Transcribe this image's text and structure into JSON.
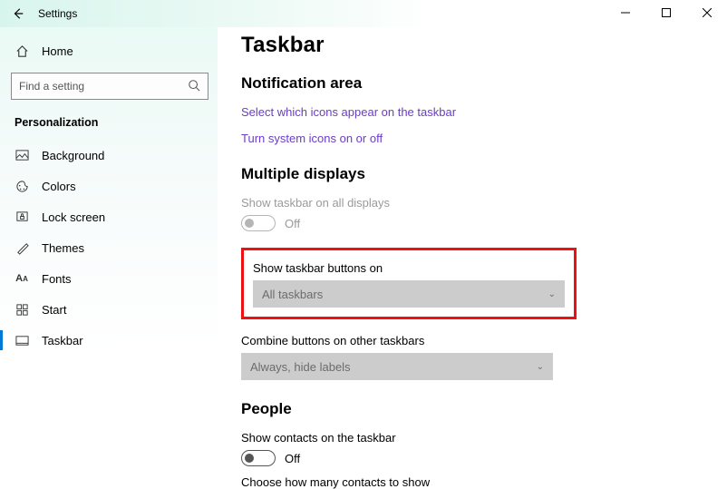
{
  "header": {
    "title": "Settings"
  },
  "sidebar": {
    "home": "Home",
    "search_placeholder": "Find a setting",
    "section": "Personalization",
    "items": [
      {
        "label": "Background",
        "icon": "image-icon"
      },
      {
        "label": "Colors",
        "icon": "palette-icon"
      },
      {
        "label": "Lock screen",
        "icon": "lock-icon"
      },
      {
        "label": "Themes",
        "icon": "brush-icon"
      },
      {
        "label": "Fonts",
        "icon": "font-icon"
      },
      {
        "label": "Start",
        "icon": "start-icon"
      },
      {
        "label": "Taskbar",
        "icon": "taskbar-icon"
      }
    ]
  },
  "main": {
    "title": "Taskbar",
    "notification": {
      "heading": "Notification area",
      "link1": "Select which icons appear on the taskbar",
      "link2": "Turn system icons on or off"
    },
    "multiple": {
      "heading": "Multiple displays",
      "show_all": "Show taskbar on all displays",
      "show_all_state": "Off",
      "show_buttons_label": "Show taskbar buttons on",
      "show_buttons_value": "All taskbars",
      "combine_label": "Combine buttons on other taskbars",
      "combine_value": "Always, hide labels"
    },
    "people": {
      "heading": "People",
      "show_contacts": "Show contacts on the taskbar",
      "show_contacts_state": "Off",
      "choose_label": "Choose how many contacts to show"
    }
  }
}
